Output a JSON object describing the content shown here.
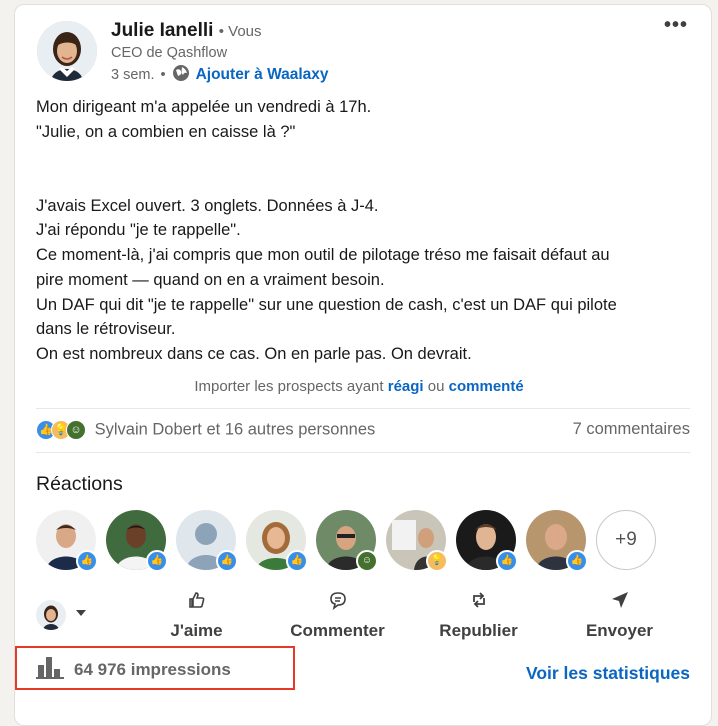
{
  "author": {
    "name": "Julie Ianelli",
    "connection": "• Vous",
    "headline": "CEO de Qashflow",
    "time": "3 sem.",
    "time_separator": "•",
    "waalaxy_link": "Ajouter à Waalaxy"
  },
  "menu_icon": "more-dots-icon",
  "post": {
    "lines": [
      "Mon dirigeant m'a appelée un vendredi à 17h.",
      "\"Julie, on a combien en caisse là ?\"",
      "",
      "",
      "J'avais Excel ouvert. 3 onglets. Données à J-4.",
      "J'ai répondu \"je te rappelle\".",
      "Ce moment-là, j'ai compris que mon outil de pilotage tréso me faisait défaut au",
      "pire moment — quand on en a vraiment besoin.",
      "Un DAF qui dit \"je te rappelle\" sur une question de cash, c'est un DAF qui pilote",
      "dans le rétroviseur.",
      "On est nombreux dans ce cas. On en parle pas. On devrait."
    ]
  },
  "import": {
    "prefix": "Importer les prospects ayant",
    "link1": "réagi",
    "middle": "ou",
    "link2": "commenté"
  },
  "social": {
    "reactors_text": "Sylvain Dobert et 16 autres personnes",
    "comments_text": "7 commentaires"
  },
  "reactions": {
    "title": "Réactions",
    "more": "+9"
  },
  "actions": {
    "like": "J'aime",
    "comment": "Commenter",
    "repost": "Republier",
    "send": "Envoyer"
  },
  "footer": {
    "impressions": "64 976 impressions",
    "stats_link": "Voir les statistiques"
  },
  "colors": {
    "link_blue": "#0a66c2",
    "highlight_red": "#e53a27",
    "like_blue": "#378fe9",
    "celebrate_green": "#44712e",
    "insight_yellow": "#f5bb5c"
  }
}
